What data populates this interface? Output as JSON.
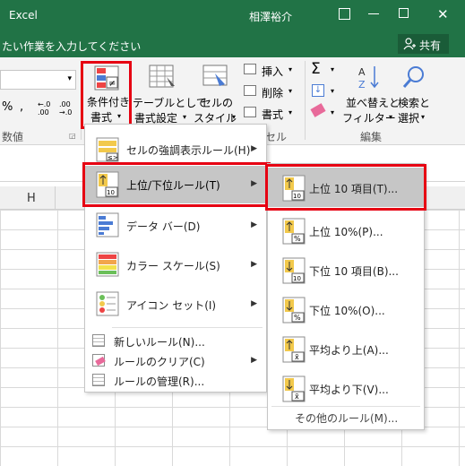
{
  "titlebar": {
    "app_name": "Excel",
    "user_name": "相澤裕介"
  },
  "tellme": {
    "placeholder": "たい作業を入力してください",
    "share_label": "共有"
  },
  "ribbon": {
    "cond_format_line1": "条件付き",
    "cond_format_line2": "書式",
    "table_format_line1": "テーブルとして",
    "table_format_line2": "書式設定",
    "cell_style_line1": "セルの",
    "cell_style_line2": "スタイル",
    "insert_label": "挿入",
    "delete_label": "削除",
    "format_label": "書式",
    "sort_line1": "並べ替えと",
    "sort_line2": "フィルター",
    "find_line1": "検索と",
    "find_line2": "選択",
    "group_number": "数値",
    "group_cells": "セル",
    "group_edit": "編集",
    "percent_glyph": "%",
    "comma_glyph": ",",
    "dec_inc": "←.0 .00",
    "dec_dec": ".00 →.0"
  },
  "sheet": {
    "column_h": "H"
  },
  "main_menu": {
    "items": [
      {
        "label": "セルの強調表示ルール(H)"
      },
      {
        "label": "上位/下位ルール(T)"
      },
      {
        "label": "データ バー(D)"
      },
      {
        "label": "カラー スケール(S)"
      },
      {
        "label": "アイコン セット(I)"
      }
    ],
    "small_items": [
      {
        "label": "新しいルール(N)..."
      },
      {
        "label": "ルールのクリア(C)"
      },
      {
        "label": "ルールの管理(R)..."
      }
    ]
  },
  "sub_menu": {
    "items": [
      {
        "label": "上位 10 項目(T)...",
        "badge": "10"
      },
      {
        "label": "上位 10%(P)...",
        "badge": "%"
      },
      {
        "label": "下位 10 項目(B)...",
        "badge": "10"
      },
      {
        "label": "下位 10%(O)...",
        "badge": "%"
      },
      {
        "label": "平均より上(A)...",
        "badge": "x̄"
      },
      {
        "label": "平均より下(V)...",
        "badge": "x̄"
      }
    ],
    "more_rules": "その他のルール(M)..."
  },
  "colors": {
    "excel_green": "#217346",
    "highlight_red": "#e60012",
    "menu_highlight": "#c6c6c6"
  }
}
